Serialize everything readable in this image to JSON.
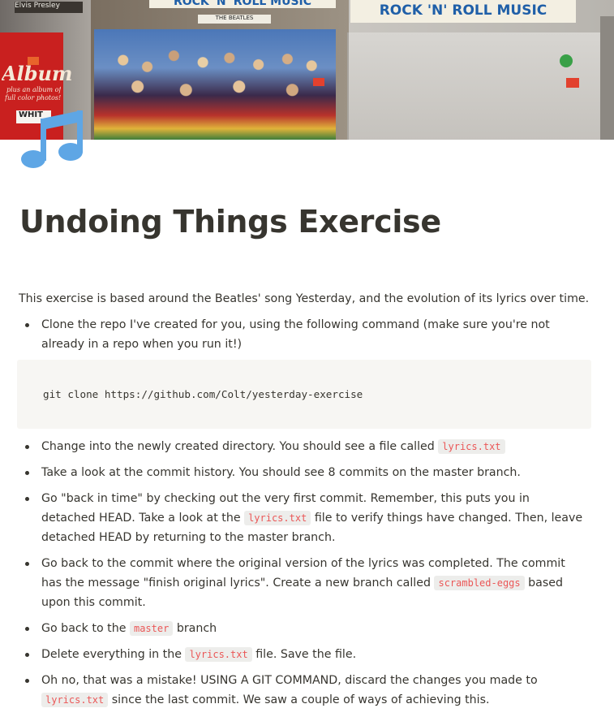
{
  "cover": {
    "signs": [
      "Elvis Presley",
      "ROCK 'N' ROLL MUSIC",
      "THE BEATLES",
      "ROCK 'N' ROLL MUSIC"
    ],
    "album_lines": [
      "Album",
      "plus an album of",
      "full color photos!",
      "WHIT"
    ],
    "colors": {
      "sign_bg": "#f3efe2",
      "sign_text": "#1f5fa8",
      "album_red": "#c9201f"
    }
  },
  "page": {
    "icon": "musical-notes-icon",
    "title": "Undoing Things Exercise",
    "intro": "This exercise is based around the Beatles' song Yesterday, and the evolution of its lyrics over time."
  },
  "steps": [
    {
      "text": "Clone the repo I've created for you, using the following command (make sure you're not already in a repo when you run it!)"
    },
    {
      "before": "Change into the newly created directory.  You should see a file called ",
      "code": "lyrics.txt",
      "after": ""
    },
    {
      "text": "Take a look at the commit history.  You should see 8 commits on the master branch."
    },
    {
      "before": "Go \"back in time\" by checking out the very first commit.  Remember, this puts you in detached HEAD.  Take a look at the ",
      "code": "lyrics.txt",
      "after": " file to verify things have changed.  Then, leave detached HEAD by returning to the master branch."
    },
    {
      "before": "Go back to the commit where the original version of the lyrics was completed.  The commit has the message \"finish original lyrics\".  Create a new branch called ",
      "code": "scrambled-eggs",
      "after": " based upon this commit."
    },
    {
      "before": "Go back to the ",
      "code": "master",
      "after": " branch"
    },
    {
      "before": "Delete everything in the ",
      "code": "lyrics.txt",
      "after": " file.  Save the file."
    },
    {
      "before": "Oh no, that was a mistake!  USING A GIT COMMAND, discard the changes you made to ",
      "code": "lyrics.txt",
      "after": " since the last commit. We saw a couple of ways of achieving this."
    }
  ],
  "code_block": "git clone https://github.com/Colt/yesterday-exercise",
  "colors": {
    "text": "#37352f",
    "inline_code": "#eb5757",
    "code_bg": "#f7f6f3",
    "icon": "#5ea6e5"
  }
}
